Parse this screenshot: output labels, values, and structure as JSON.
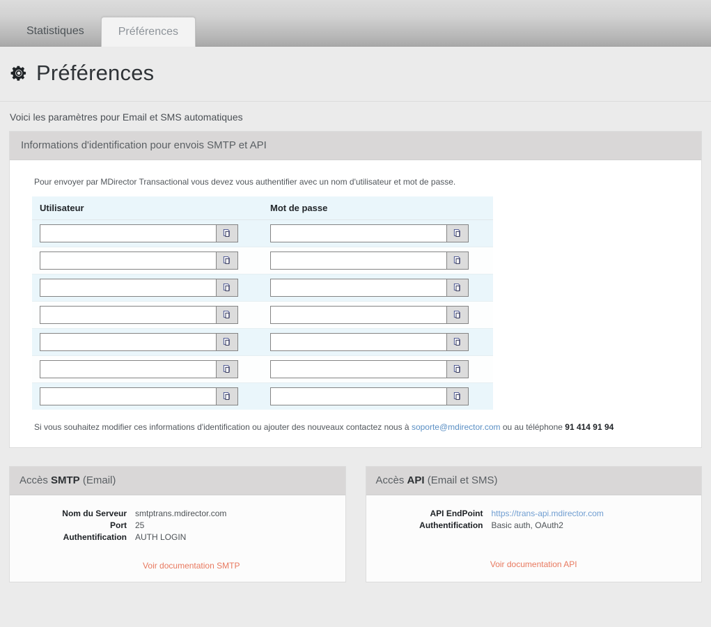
{
  "tabs": [
    {
      "label": "Statistiques",
      "active": false
    },
    {
      "label": "Préférences",
      "active": true
    }
  ],
  "page": {
    "title": "Préférences",
    "icon": "gear-icon",
    "description": "Voici les paramètres pour Email et SMS automatiques"
  },
  "credentials_panel": {
    "header": "Informations d'identification pour envois SMTP et API",
    "intro": "Pour envoyer par MDirector Transactional vous devez vous authentifier avec un nom d'utilisateur et mot de passe.",
    "columns": [
      "Utilisateur",
      "Mot de passe"
    ],
    "rows": [
      {
        "user": "",
        "password": ""
      },
      {
        "user": "",
        "password": ""
      },
      {
        "user": "",
        "password": ""
      },
      {
        "user": "",
        "password": ""
      },
      {
        "user": "",
        "password": ""
      },
      {
        "user": "",
        "password": ""
      },
      {
        "user": "",
        "password": ""
      }
    ],
    "copy_icon": "copy-icon",
    "contact_note": {
      "before": "Si vous souhaitez modifier ces informations d'identification ou ajouter des nouveaux contactez nous à ",
      "email": "soporte@mdirector.com",
      "middle": " ou au téléphone ",
      "phone": "91 414 91 94"
    }
  },
  "smtp_card": {
    "header_prefix": "Accès ",
    "header_strong": "SMTP",
    "header_suffix": " (Email)",
    "rows": [
      {
        "label": "Nom du Serveur",
        "value": "smtptrans.mdirector.com",
        "is_link": false
      },
      {
        "label": "Port",
        "value": "25",
        "is_link": false
      },
      {
        "label": "Authentification",
        "value": "AUTH LOGIN",
        "is_link": false
      }
    ],
    "doc_link": "Voir documentation SMTP"
  },
  "api_card": {
    "header_prefix": "Accès ",
    "header_strong": "API",
    "header_suffix": " (Email et SMS)",
    "rows": [
      {
        "label": "API EndPoint",
        "value": "https://trans-api.mdirector.com",
        "is_link": true
      },
      {
        "label": "Authentification",
        "value": "Basic auth, OAuth2",
        "is_link": false
      }
    ],
    "doc_link": "Voir documentation API"
  },
  "colors": {
    "accent_link": "#e8795f",
    "url_link": "#6f9dd1",
    "panel_header_bg": "#d9d7d7",
    "table_stripe": "#eaf6fb",
    "page_bg": "#ebebeb"
  }
}
